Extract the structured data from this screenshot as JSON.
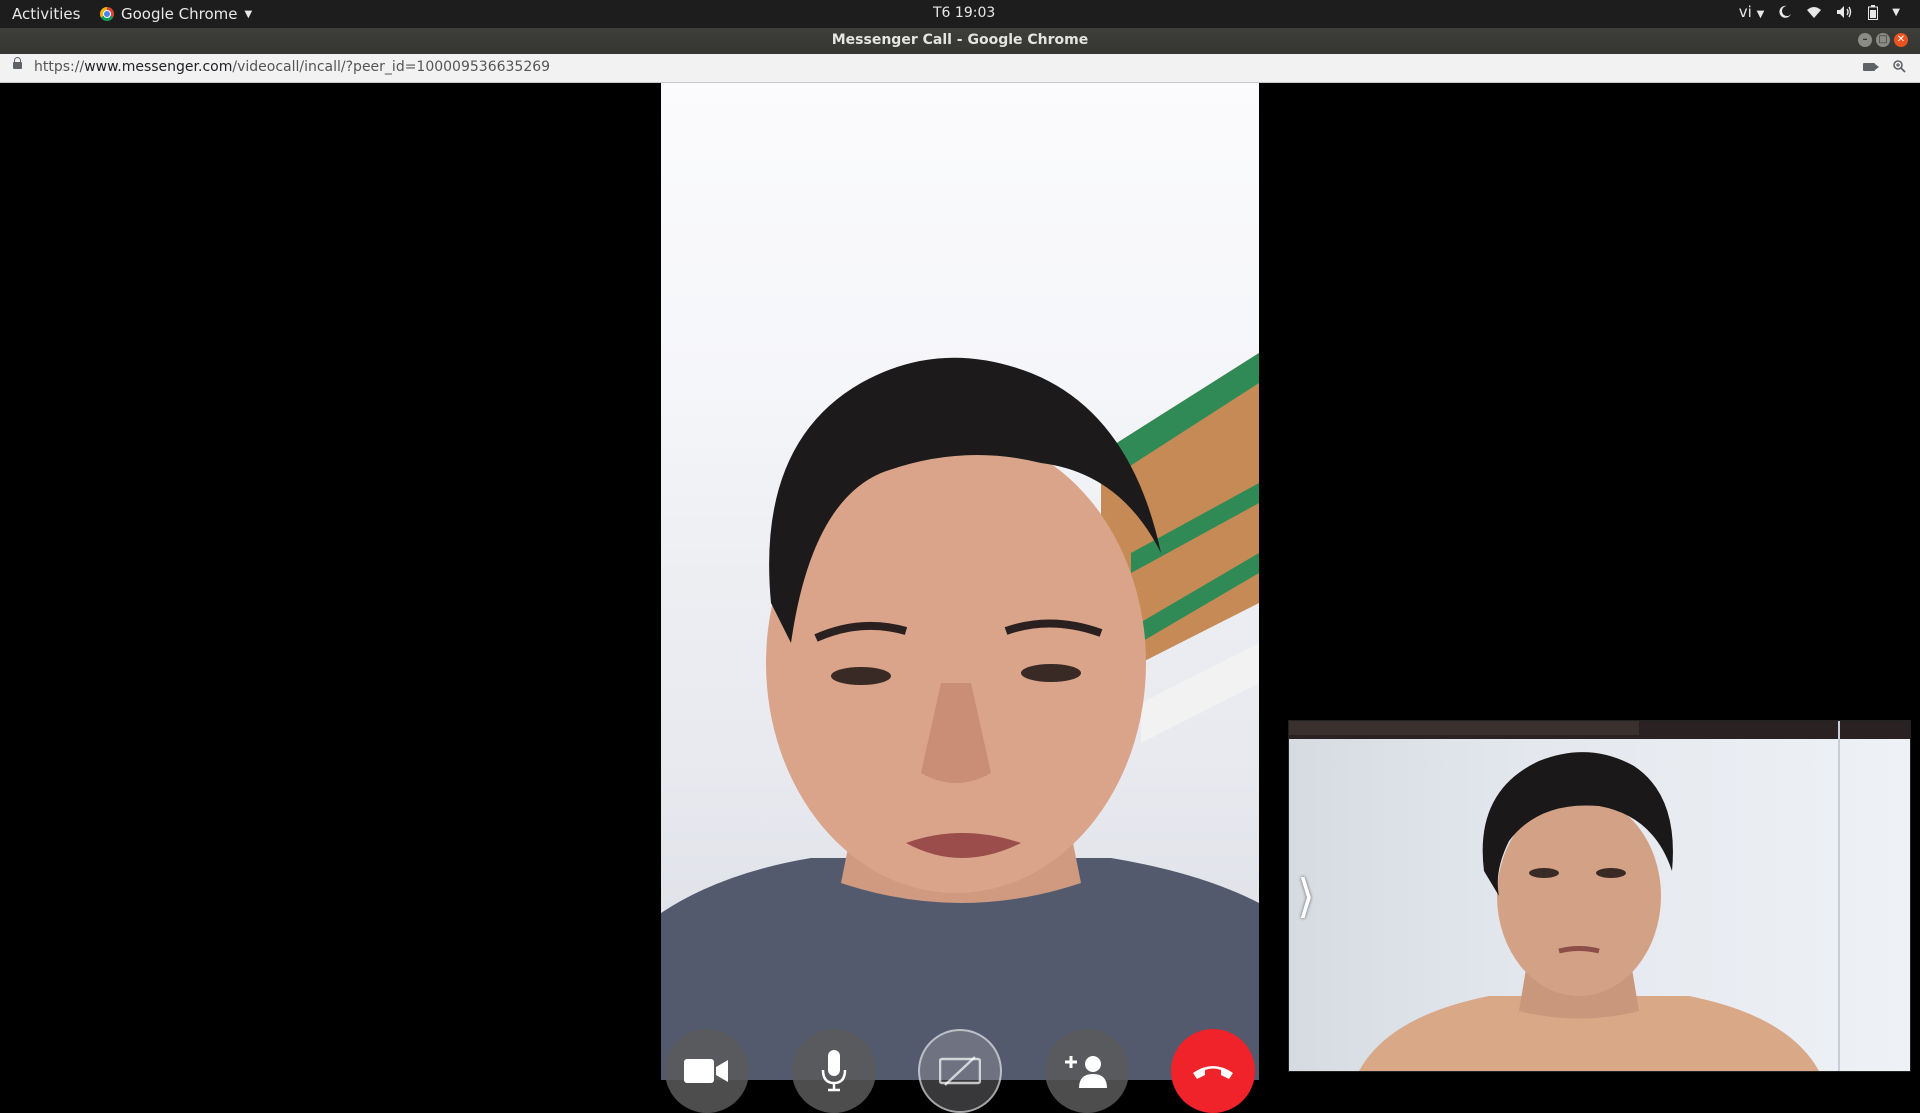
{
  "topbar": {
    "activities_label": "Activities",
    "app_menu_label": "Google Chrome",
    "clock": "T6 19:03",
    "input_method": "vi"
  },
  "window": {
    "title": "Messenger Call - Google Chrome"
  },
  "address_bar": {
    "url_scheme": "https://",
    "url_host": "www.messenger.com",
    "url_path": "/videocall/incall/?peer_id=100009536635269"
  },
  "call": {
    "controls": [
      {
        "name": "camera-toggle",
        "icon": "video-camera-icon",
        "state": "on"
      },
      {
        "name": "microphone-toggle",
        "icon": "microphone-icon",
        "state": "on"
      },
      {
        "name": "screen-share",
        "icon": "screen-share-off-icon",
        "state": "disabled"
      },
      {
        "name": "add-participant",
        "icon": "add-person-icon",
        "state": "enabled"
      },
      {
        "name": "end-call",
        "icon": "hang-up-icon",
        "state": "enabled"
      }
    ],
    "colors": {
      "hangup": "#f0222a",
      "control_bg": "#5a5a5a"
    }
  }
}
